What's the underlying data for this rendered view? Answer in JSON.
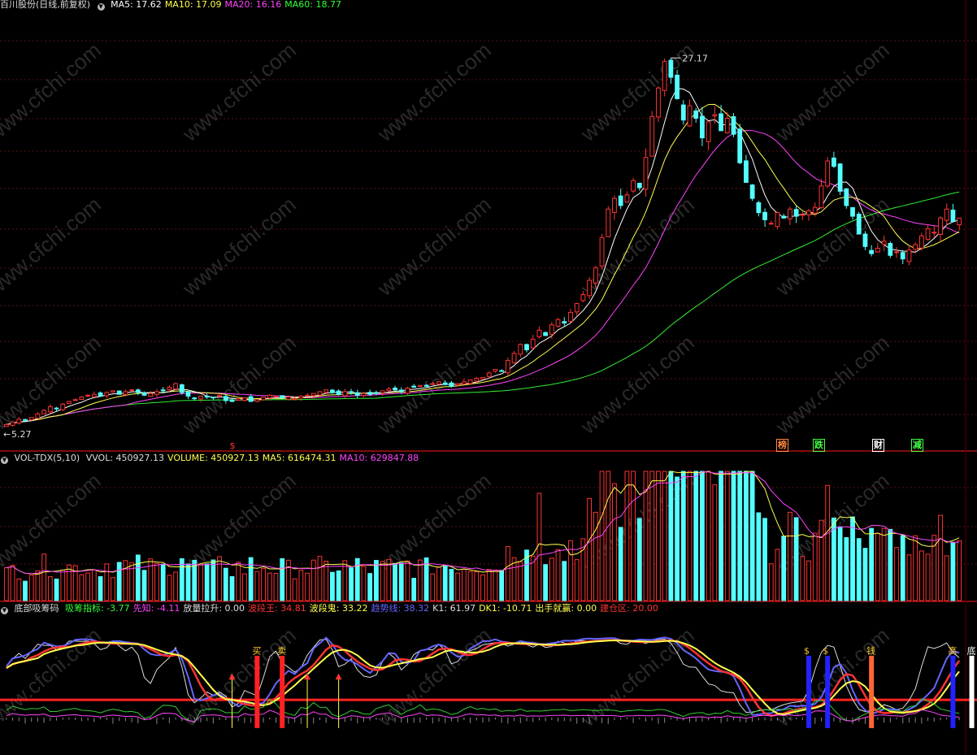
{
  "price_panel": {
    "stock": "百川股份(日线,前复权)",
    "indicators": [
      {
        "label": "MA5: 17.62",
        "color": "#ffffff"
      },
      {
        "label": "MA10: 17.09",
        "color": "#ffff4d"
      },
      {
        "label": "MA20: 16.16",
        "color": "#ff44ff"
      },
      {
        "label": "MA60: 18.77",
        "color": "#33ff33"
      }
    ],
    "high_label": "27.17",
    "low_label": "5.27",
    "signals": [
      {
        "text": "榜",
        "color": "#ff8844"
      },
      {
        "text": "跌",
        "color": "#44ff44"
      },
      {
        "text": "财",
        "color": "#ffffff"
      },
      {
        "text": "减",
        "color": "#44ff44"
      }
    ],
    "dollar_mark": "$"
  },
  "volume_panel": {
    "title": "VOL-TDX(5,10)",
    "indicators": [
      {
        "label": "VVOL: 450927.13",
        "color": "#dddddd"
      },
      {
        "label": "VOLUME: 450927.13",
        "color": "#ffff4d"
      },
      {
        "label": "MA5: 616474.31",
        "color": "#ffff4d"
      },
      {
        "label": "MA10: 629847.88",
        "color": "#ff44ff"
      }
    ]
  },
  "indicator_panel": {
    "title": "底部吸筹码",
    "indicators": [
      {
        "label": "吸筹指标: -3.77",
        "color": "#33ff33"
      },
      {
        "label": "先知: -4.11",
        "color": "#ff44ff"
      },
      {
        "label": "放量拉升: 0.00",
        "color": "#dddddd"
      },
      {
        "label": "波段王: 34.81",
        "color": "#ff3333"
      },
      {
        "label": "波段鬼: 33.22",
        "color": "#ffff4d"
      },
      {
        "label": "趋势线: 38.32",
        "color": "#6666ff"
      },
      {
        "label": "K1: 61.97",
        "color": "#dddddd"
      },
      {
        "label": "DK1: -10.71",
        "color": "#ffff4d"
      },
      {
        "label": "出手就赢: 0.00",
        "color": "#ffff4d"
      },
      {
        "label": "建仓区: 20.00",
        "color": "#ff3333"
      }
    ]
  },
  "chart_data": {
    "type": "candlestick",
    "price_axis": {
      "min": 4.5,
      "max": 28.5
    },
    "closes": [
      5.3,
      5.45,
      5.6,
      5.55,
      5.7,
      5.9,
      6.1,
      6.3,
      6.2,
      6.45,
      6.6,
      6.7,
      6.85,
      6.95,
      7.0,
      6.9,
      7.1,
      7.2,
      7.0,
      7.15,
      7.25,
      7.1,
      6.95,
      7.05,
      7.15,
      7.2,
      7.4,
      7.6,
      7.1,
      6.9,
      6.75,
      6.9,
      6.85,
      6.8,
      6.95,
      6.65,
      6.6,
      6.75,
      6.8,
      6.6,
      6.7,
      6.85,
      6.95,
      6.9,
      6.8,
      6.85,
      6.75,
      6.9,
      6.95,
      7.05,
      7.15,
      7.25,
      7.1,
      7.0,
      7.15,
      7.1,
      6.95,
      7.05,
      7.0,
      7.1,
      7.2,
      7.3,
      7.25,
      7.15,
      7.35,
      7.4,
      7.5,
      7.45,
      7.6,
      7.7,
      7.55,
      7.45,
      7.6,
      7.7,
      7.8,
      7.9,
      7.95,
      8.2,
      8.4,
      8.3,
      8.9,
      9.3,
      9.8,
      9.5,
      10.1,
      10.6,
      10.3,
      10.9,
      11.2,
      11.0,
      11.6,
      12.1,
      12.6,
      13.4,
      14.1,
      15.8,
      17.4,
      18.0,
      17.6,
      18.2,
      19.0,
      18.6,
      20.3,
      22.6,
      24.2,
      25.7,
      24.8,
      23.6,
      22.4,
      23.2,
      22.5,
      21.4,
      22.3,
      22.7,
      21.8,
      22.5,
      21.6,
      20.0,
      18.9,
      18.0,
      17.2,
      16.8,
      16.6,
      17.2,
      16.9,
      17.4,
      17.0,
      17.1,
      17.3,
      17.5,
      18.7,
      20.1,
      19.8,
      18.4,
      17.6,
      17.0,
      16.0,
      15.3,
      14.9,
      15.2,
      15.6,
      14.8,
      15.0,
      14.6,
      15.1,
      15.4,
      15.9,
      16.3,
      16.1,
      16.9,
      17.4,
      16.7,
      16.9
    ],
    "volume_axis": {
      "min": 0,
      "max": 1050000
    },
    "indicator_axis": {
      "min": -25,
      "max": 115
    },
    "baseline_value": 20,
    "buy_arrows": [
      36,
      48,
      53
    ],
    "signal_bars": [
      {
        "index": 40,
        "color": "#ff2222",
        "label": "买"
      },
      {
        "index": 44,
        "color": "#ff2222",
        "label": "卖"
      },
      {
        "index": 128,
        "color": "#2222ff",
        "label": "$"
      },
      {
        "index": 131,
        "color": "#2222ff",
        "label": "$"
      },
      {
        "index": 138,
        "color": "#ff6633",
        "label": "钱"
      },
      {
        "index": 151,
        "color": "#2222ff",
        "label": "高"
      },
      {
        "index": 154,
        "color": "#ffffff",
        "label": "底"
      },
      {
        "index": 159,
        "color": "#ff6633",
        "label": "底"
      }
    ]
  },
  "watermark": "www.cfchi.com"
}
